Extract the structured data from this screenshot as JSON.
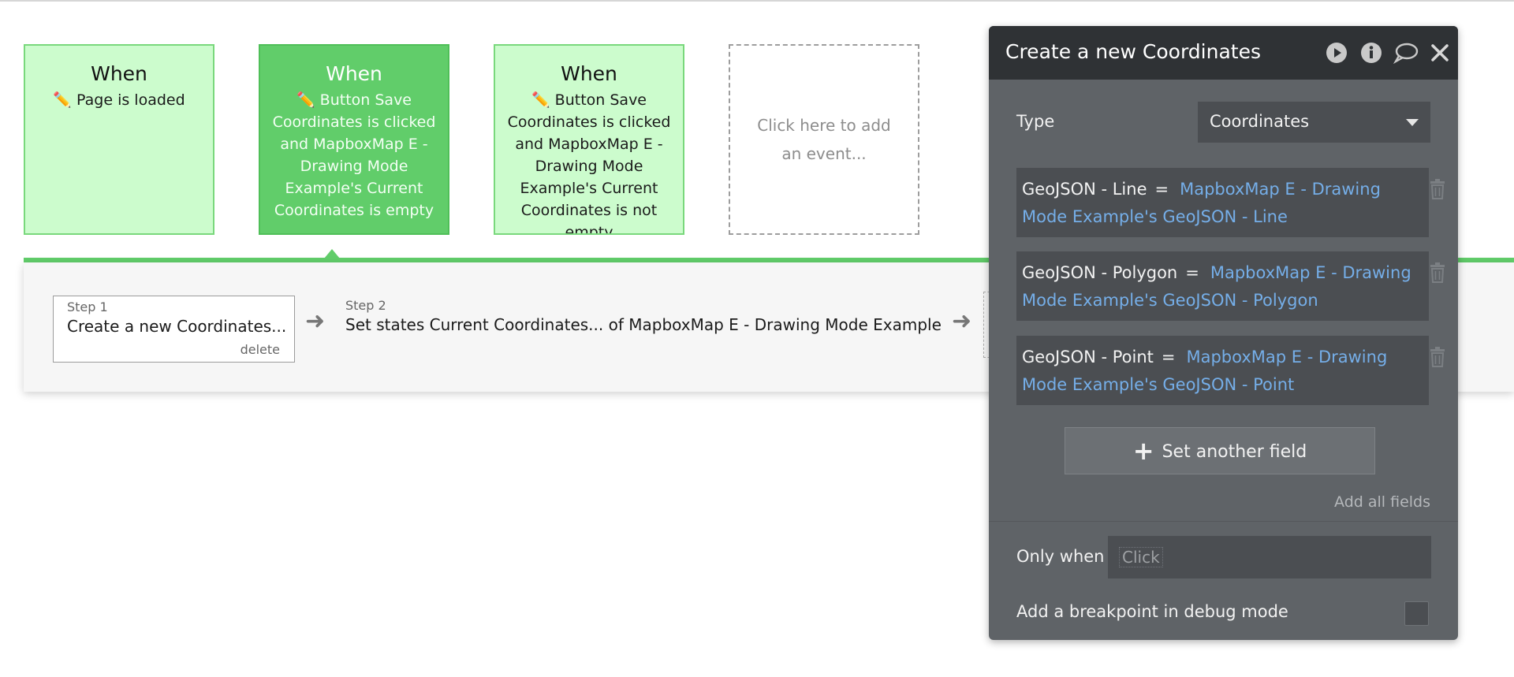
{
  "events": [
    {
      "when": "When",
      "condition": "✏️ Page is loaded"
    },
    {
      "when": "When",
      "condition": "✏️ Button Save Coordinates is clicked and MapboxMap E - Drawing Mode Example's Current Coordinates is empty"
    },
    {
      "when": "When",
      "condition": "✏️ Button Save Coordinates is clicked and MapboxMap E - Drawing Mode Example's Current Coordinates is not empty"
    }
  ],
  "add_event_text": "Click here to add an event...",
  "steps": [
    {
      "number": "Step 1",
      "title": "Create a new Coordinates...",
      "delete_label": "delete"
    },
    {
      "number": "Step 2",
      "title": "Set states Current Coordinates... of MapboxMap E - Drawing Mode Example"
    }
  ],
  "editor": {
    "title": "Create a new Coordinates",
    "type_label": "Type",
    "type_value": "Coordinates",
    "fields": [
      {
        "name": "GeoJSON - Line",
        "op": "=",
        "value": "MapboxMap E - Drawing Mode Example's GeoJSON - Line"
      },
      {
        "name": "GeoJSON - Polygon",
        "op": "=",
        "value": "MapboxMap E - Drawing Mode Example's GeoJSON - Polygon"
      },
      {
        "name": "GeoJSON - Point",
        "op": "=",
        "value": "MapboxMap E - Drawing Mode Example's GeoJSON - Point"
      }
    ],
    "set_another_field": "Set another field",
    "add_all_fields": "Add all fields",
    "only_when_label": "Only when",
    "only_when_placeholder": "Click",
    "breakpoint_label": "Add a breakpoint in debug mode"
  },
  "colors": {
    "event_card": "#ccfccd",
    "event_card_selected": "#61cd6a",
    "editor_bg": "#5f6367",
    "editor_header": "#2f3235",
    "dynamic_text": "#75aee8"
  }
}
